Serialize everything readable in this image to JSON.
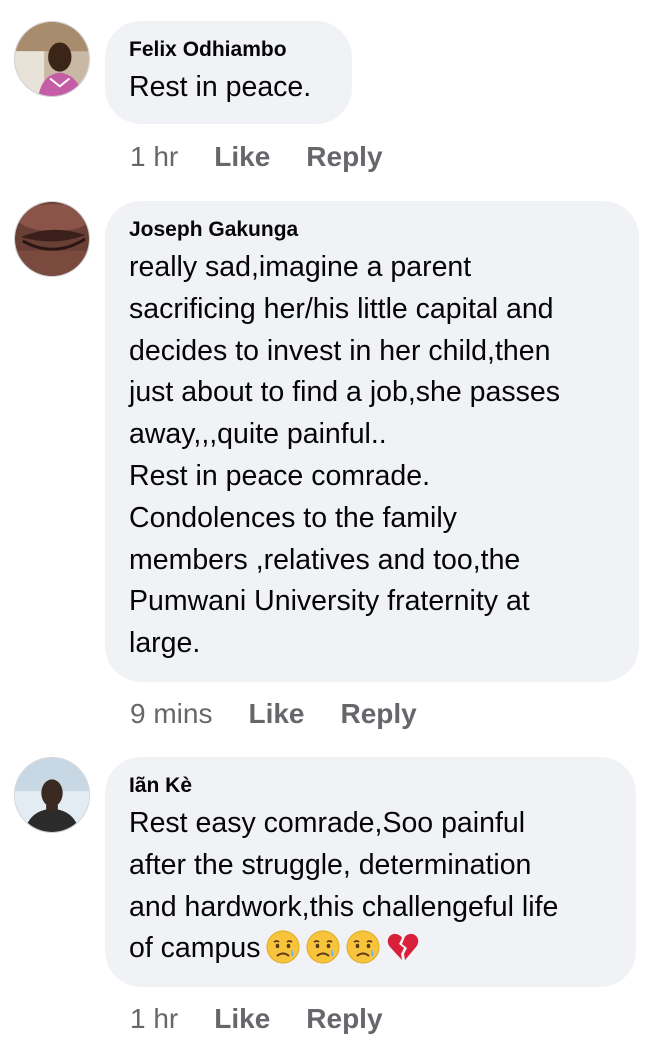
{
  "comments": [
    {
      "author": "Felix Odhiambo",
      "lines": [
        "Rest in peace."
      ],
      "time": "1 hr",
      "like": "Like",
      "reply": "Reply"
    },
    {
      "author": "Joseph Gakunga",
      "lines": [
        "really sad,imagine a parent",
        "sacrificing her/his little capital and",
        "decides to invest in her child,then",
        "just about to find a job,she passes",
        "away,,,quite painful..",
        "Rest in peace comrade.",
        "Condolences to the family",
        "members ,relatives and too,the",
        "Pumwani University fraternity at",
        "large."
      ],
      "time": "9 mins",
      "like": "Like",
      "reply": "Reply"
    },
    {
      "author": "Iãn Kè",
      "lines": [
        "Rest easy comrade,Soo painful",
        "after the struggle, determination",
        "and hardwork,this challengeful life",
        "of campus"
      ],
      "emojis": [
        "sad-but-relieved-face",
        "sad-but-relieved-face",
        "sad-but-relieved-face",
        "broken-heart"
      ],
      "time": "1 hr",
      "like": "Like",
      "reply": "Reply"
    }
  ],
  "colors": {
    "bubble": "#f0f2f5",
    "text": "#050505",
    "meta": "#65676b"
  }
}
